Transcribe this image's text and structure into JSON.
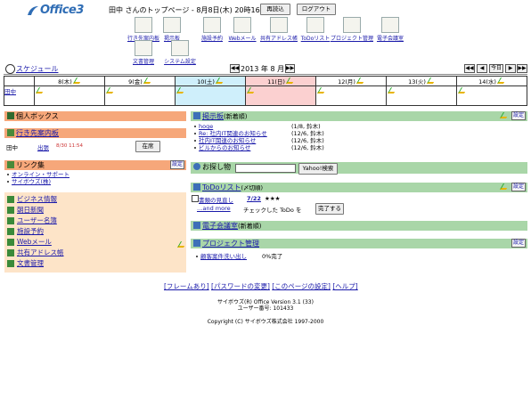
{
  "header": {
    "logo": "Office3",
    "logo_sub": "CYBOZU OFFICE",
    "greeting": "田中 さんのトップページ - 8月8日(木) 20時16分",
    "reload_label": "再読込",
    "logout_label": "ログアウト"
  },
  "apps_row1": [
    {
      "label": "行き先案内板",
      "icon": "board-icon"
    },
    {
      "label": "掲示板",
      "icon": "bulletin-icon"
    },
    {
      "label": "施設予約",
      "icon": "facility-icon"
    },
    {
      "label": "Webメール",
      "icon": "mail-icon"
    },
    {
      "label": "共有アドレス帳",
      "icon": "address-icon"
    },
    {
      "label": "ToDoリスト",
      "icon": "todo-icon"
    },
    {
      "label": "プロジェクト管理",
      "icon": "project-icon"
    },
    {
      "label": "電子会議室",
      "icon": "meeting-icon"
    }
  ],
  "apps_row2": [
    {
      "label": "文書管理",
      "icon": "document-icon"
    },
    {
      "label": "システム設定",
      "icon": "settings-icon"
    }
  ],
  "schedule": {
    "title": "スケジュール",
    "month_label": "2013 年 8 月",
    "today_label": "今日",
    "days": [
      "8(木)",
      "9(金)",
      "10(土)",
      "11(日)",
      "12(月)",
      "13(火)",
      "14(水)"
    ],
    "user": "田中"
  },
  "personal_box": {
    "title": "個人ボックス"
  },
  "dest_board": {
    "title": "行き先案内板",
    "name": "田中",
    "status": "出張",
    "time": "8/30 11:54",
    "zaiseki_label": "在席"
  },
  "links": {
    "title": "リンク集",
    "setting_label": "設定",
    "items": [
      "オンライン・サポート",
      "サイボウズ(株)"
    ]
  },
  "menu": {
    "items": [
      "ビジネス情報",
      "朝日新聞",
      "ユーザー名簿",
      "施設予約",
      "Webメール",
      "共有アドレス帳",
      "文書管理"
    ]
  },
  "bulletin": {
    "title": "掲示板",
    "suffix": "(新着順)",
    "setting_label": "設定",
    "posts": [
      {
        "title": "hoge",
        "meta": "(1/8, 鈴木)"
      },
      {
        "title": "Re: 社内IT関連のお知らせ",
        "meta": "(12/6, 鈴木)"
      },
      {
        "title": "社内IT関連のお知らせ",
        "meta": "(12/6, 鈴木)"
      },
      {
        "title": "ビルからのお知らせ",
        "meta": "(12/6, 鈴木)"
      }
    ]
  },
  "search": {
    "title": "お探し物",
    "button_label": "Yahoo!検索"
  },
  "todo": {
    "title": "ToDoリスト",
    "suffix": "(〆切順)",
    "setting_label": "設定",
    "item_title": "書類の見直し",
    "item_date": "7/22",
    "item_stars": "★★★",
    "and_more": "…and more",
    "check_text": "チェックした ToDo を",
    "done_label": "完了する"
  },
  "meeting": {
    "title": "電子会議室",
    "suffix": "(新着順)"
  },
  "project": {
    "title": "プロジェクト管理",
    "setting_label": "設定",
    "item": "顧客案件洗い出し",
    "progress": "0%完了"
  },
  "footer": {
    "links": [
      "[フレームあり]",
      "[パスワードの変更]",
      "[このページの設定]",
      "[ヘルプ]"
    ],
    "version": "サイボウズ(R) Office Version 3.1 (33)",
    "user_no": "ユーザー番号: 101433",
    "copyright": "Copyright (C) サイボウズ株式会社 1997-2000"
  }
}
